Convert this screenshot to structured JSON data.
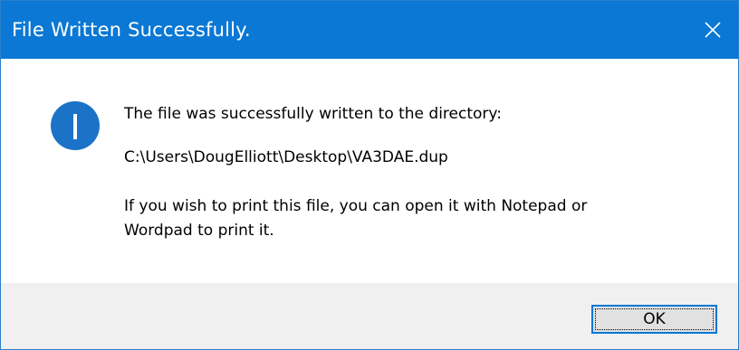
{
  "window": {
    "title": "File Written Successfully."
  },
  "dialog": {
    "icon": "info-icon",
    "message_line1": "The file was successfully written to the directory:",
    "path": "C:\\Users\\DougElliott\\Desktop\\VA3DAE.dup",
    "message_line3a": "If you wish to print this file, you can open it with Notepad or",
    "message_line3b": "Wordpad to print it."
  },
  "buttons": {
    "ok_label": "OK",
    "close_icon": "close-icon"
  },
  "colors": {
    "titlebar": "#0a78d4",
    "icon_blue": "#1a73c6",
    "footer_bg": "#f0f0f0",
    "button_bg": "#e1e1e1",
    "button_focus": "#0078d7"
  }
}
